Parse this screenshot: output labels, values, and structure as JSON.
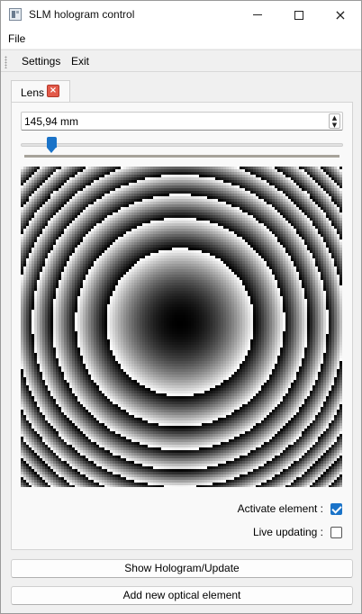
{
  "window": {
    "title": "SLM hologram control",
    "icon": "app-window-icon",
    "controls": {
      "minimize": "minimize-icon",
      "maximize": "maximize-icon",
      "close": "×"
    }
  },
  "menubar": {
    "file_label": "File"
  },
  "toolbar": {
    "settings_label": "Settings",
    "exit_label": "Exit"
  },
  "tabs": [
    {
      "label": "Lens",
      "close_glyph": "×",
      "active": true
    }
  ],
  "lens": {
    "focal_value": "145,94 mm",
    "spin_up": "▲",
    "spin_down": "▼",
    "slider_fraction": 0.083,
    "hologram": {
      "pattern": "fresnel-lens-phase",
      "rings": 4
    },
    "activate_label": "Activate element :",
    "activate_checked": true,
    "live_label": "Live updating :",
    "live_checked": false
  },
  "buttons": {
    "show_label": "Show Hologram/Update",
    "add_label": "Add new optical element"
  },
  "colors": {
    "accent": "#1a73c8",
    "tab_close": "#e25a4a",
    "tick_bar": "#a7a39a"
  }
}
